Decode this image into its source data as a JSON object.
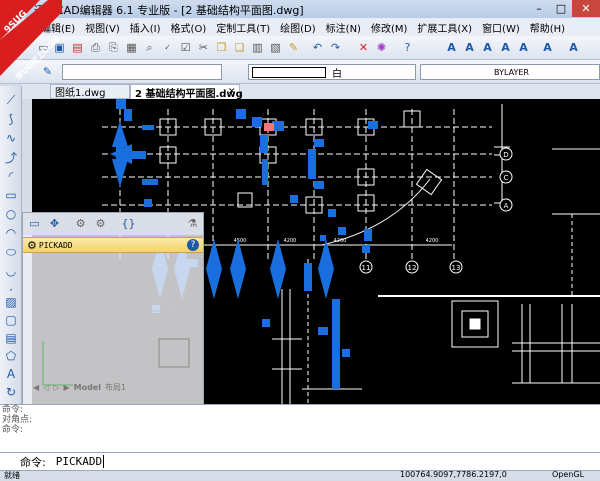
{
  "window": {
    "title": "迅捷CAD编辑器 6.1 专业版 - [2 基础结构平面图.dwg]",
    "minimize": "–",
    "maximize": "□",
    "close": "✕"
  },
  "watermark": {
    "line1": "9SUG",
    "line2": "学UG就上UG网"
  },
  "menu": [
    "编辑(E)",
    "视图(V)",
    "插入(I)",
    "格式(O)",
    "定制工具(T)",
    "绘图(D)",
    "标注(N)",
    "修改(M)",
    "扩展工具(X)",
    "窗口(W)",
    "帮助(H)"
  ],
  "property_bar": {
    "color_value": "白",
    "linetype_value": "BYLAYER"
  },
  "tabs": [
    {
      "label": "图纸1.dwg",
      "active": false
    },
    {
      "label": "2 基础结构平面图.dwg",
      "active": true
    }
  ],
  "tab_close": "✕",
  "drawing": {
    "column_labels": [
      "11",
      "12",
      "13"
    ],
    "row_labels": [
      "D",
      "C",
      "A"
    ],
    "dims": [
      "4200",
      "4200",
      "4500",
      "4200",
      "4200",
      "4200"
    ]
  },
  "panel": {
    "command_name": "PICKADD",
    "help": "?",
    "layout_tabs": [
      "Model",
      "布局1"
    ]
  },
  "command_history": [
    "命令:",
    "对角点:",
    "命令:"
  ],
  "command_prompt": "命令:",
  "command_input": "PICKADD",
  "status": {
    "left": "就绪",
    "coords": "100764.9097,7786.2197,0",
    "opengl": "OpenGL"
  },
  "colors": {
    "accent": "#1e7be0",
    "drawing_bg": "#000000",
    "grip": "#1a6fe0"
  }
}
